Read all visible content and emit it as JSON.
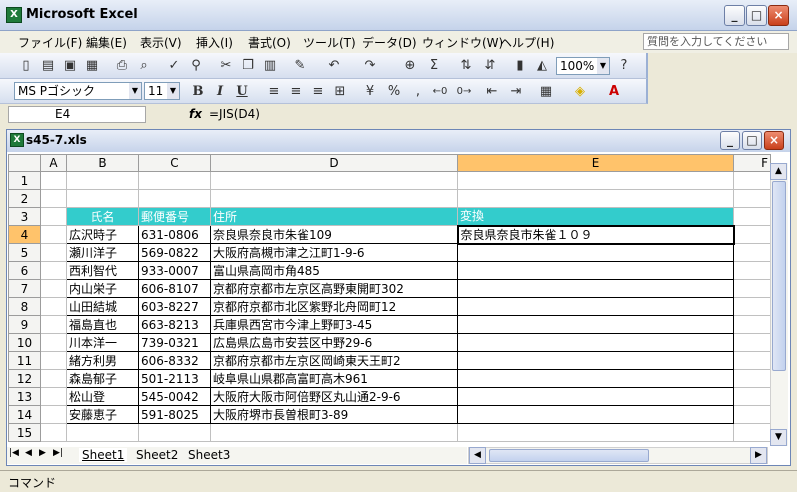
{
  "app": {
    "title": "Microsoft Excel"
  },
  "menu": [
    "ファイル(F)",
    "編集(E)",
    "表示(V)",
    "挿入(I)",
    "書式(O)",
    "ツール(T)",
    "データ(D)",
    "ウィンドウ(W)",
    "ヘルプ(H)"
  ],
  "help_box": {
    "placeholder": "質問を入力してください"
  },
  "toolbar": {
    "zoom": "100%",
    "font_name": "MS Pゴシック",
    "font_size": "11",
    "bold": "B",
    "italic": "I",
    "underline": "U",
    "percent": "%",
    "comma": ","
  },
  "formula_bar": {
    "cell_ref": "E4",
    "fx": "fx",
    "formula": "=JIS(D4)"
  },
  "workbook": {
    "title": "s45-7.xls"
  },
  "grid": {
    "columns": [
      "A",
      "B",
      "C",
      "D",
      "E",
      "F"
    ],
    "rows": [
      "1",
      "2",
      "3",
      "4",
      "5",
      "6",
      "7",
      "8",
      "9",
      "10",
      "11",
      "12",
      "13",
      "14",
      "15"
    ],
    "header": {
      "name": "氏名",
      "zip": "郵便番号",
      "address": "住所",
      "converted": "変換"
    },
    "data": [
      {
        "name": "広沢時子",
        "zip": "631-0806",
        "address": "奈良県奈良市朱雀109",
        "converted": "奈良県奈良市朱雀１０９"
      },
      {
        "name": "瀬川洋子",
        "zip": "569-0822",
        "address": "大阪府高槻市津之江町1-9-6",
        "converted": ""
      },
      {
        "name": "西利智代",
        "zip": "933-0007",
        "address": "富山県高岡市角485",
        "converted": ""
      },
      {
        "name": "内山栄子",
        "zip": "606-8107",
        "address": "京都府京都市左京区高野東開町302",
        "converted": ""
      },
      {
        "name": "山田結城",
        "zip": "603-8227",
        "address": "京都府京都市北区紫野北舟岡町12",
        "converted": ""
      },
      {
        "name": "福島直也",
        "zip": "663-8213",
        "address": "兵庫県西宮市今津上野町3-45",
        "converted": ""
      },
      {
        "name": "川本洋一",
        "zip": "739-0321",
        "address": "広島県広島市安芸区中野29-6",
        "converted": ""
      },
      {
        "name": "緒方利男",
        "zip": "606-8332",
        "address": "京都府京都市左京区岡崎東天王町2",
        "converted": ""
      },
      {
        "name": "森島郁子",
        "zip": "501-2113",
        "address": "岐阜県山県郡高富町高木961",
        "converted": ""
      },
      {
        "name": "松山登",
        "zip": "545-0042",
        "address": "大阪府大阪市阿倍野区丸山通2-9-6",
        "converted": ""
      },
      {
        "name": "安藤恵子",
        "zip": "591-8025",
        "address": "大阪府堺市長曽根町3-89",
        "converted": ""
      }
    ]
  },
  "sheets": [
    "Sheet1",
    "Sheet2",
    "Sheet3"
  ],
  "status": {
    "text": "コマンド"
  },
  "colors": {
    "header_fill": "#33cccc",
    "selected_header": "#ffc36b"
  }
}
